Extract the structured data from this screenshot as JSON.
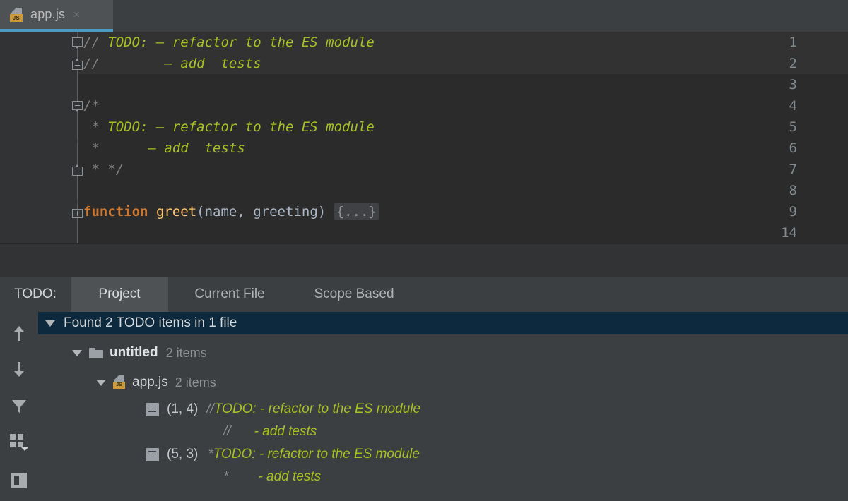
{
  "editor": {
    "tab": {
      "filename": "app.js",
      "badge": "JS",
      "close": "×"
    },
    "line_numbers": [
      "1",
      "2",
      "3",
      "4",
      "5",
      "6",
      "7",
      "8",
      "9",
      "14"
    ],
    "lines": [
      {
        "n": "1",
        "highlight": true,
        "segments": [
          {
            "t": "// ",
            "c": "cmt"
          },
          {
            "t": "TODO: – refactor to the ES module",
            "c": "todo"
          }
        ]
      },
      {
        "n": "2",
        "highlight": true,
        "segments": [
          {
            "t": "//        ",
            "c": "cmt"
          },
          {
            "t": "– add  tests",
            "c": "todo"
          }
        ]
      },
      {
        "n": "3",
        "highlight": false,
        "segments": []
      },
      {
        "n": "4",
        "highlight": false,
        "segments": [
          {
            "t": "/*",
            "c": "cmt"
          }
        ]
      },
      {
        "n": "5",
        "highlight": false,
        "segments": [
          {
            "t": " * ",
            "c": "cmt"
          },
          {
            "t": "TODO: – refactor to the ES module",
            "c": "todo"
          }
        ]
      },
      {
        "n": "6",
        "highlight": false,
        "segments": [
          {
            "t": " *      ",
            "c": "cmt"
          },
          {
            "t": "– add  tests",
            "c": "todo"
          }
        ]
      },
      {
        "n": "7",
        "highlight": false,
        "segments": [
          {
            "t": " * */",
            "c": "cmt"
          }
        ]
      },
      {
        "n": "8",
        "highlight": false,
        "segments": []
      },
      {
        "n": "9",
        "highlight": false,
        "segments": [
          {
            "t": "function",
            "c": "kw"
          },
          {
            "t": " ",
            "c": "plain"
          },
          {
            "t": "greet",
            "c": "fn"
          },
          {
            "t": "(name, greeting) ",
            "c": "plain"
          },
          {
            "t": "{...}",
            "c": "folded"
          }
        ]
      },
      {
        "n": "14",
        "highlight": false,
        "segments": []
      }
    ]
  },
  "panel": {
    "title": "TODO:",
    "tabs": [
      {
        "label": "Project",
        "active": true
      },
      {
        "label": "Current File",
        "active": false
      },
      {
        "label": "Scope Based",
        "active": false
      }
    ],
    "toolbar": [
      {
        "name": "previous-occurrence-button",
        "icon": "arrow-up-icon"
      },
      {
        "name": "next-occurrence-button",
        "icon": "arrow-down-icon"
      },
      {
        "name": "filter-button",
        "icon": "funnel-icon"
      },
      {
        "name": "group-by-button",
        "icon": "grid-icon"
      },
      {
        "name": "preview-source-button",
        "icon": "panel-icon"
      }
    ],
    "tree": {
      "summary": {
        "label": "Found 2 TODO items in 1 file",
        "selected": true
      },
      "module": {
        "label": "untitled",
        "count": "2 items"
      },
      "file": {
        "label": "app.js",
        "count": "2 items",
        "badge": "JS"
      },
      "items": [
        {
          "position": "(1, 4)",
          "line1_prefix": "// ",
          "line1_text": "TODO: - refactor to the ES module",
          "line2_prefix": "//",
          "line2_text": "- add  tests"
        },
        {
          "position": "(5, 3)",
          "line1_prefix": "* ",
          "line1_text": "TODO: - refactor to the ES module",
          "line2_prefix": "*",
          "line2_text": "- add  tests"
        }
      ]
    }
  },
  "colors": {
    "todo_green": "#a8c023",
    "keyword_orange": "#cc7832",
    "function_yellow": "#ffc66d",
    "selection_blue": "#0d293e",
    "tab_underline": "#4a9ac0",
    "js_badge": "#cc9a39"
  }
}
